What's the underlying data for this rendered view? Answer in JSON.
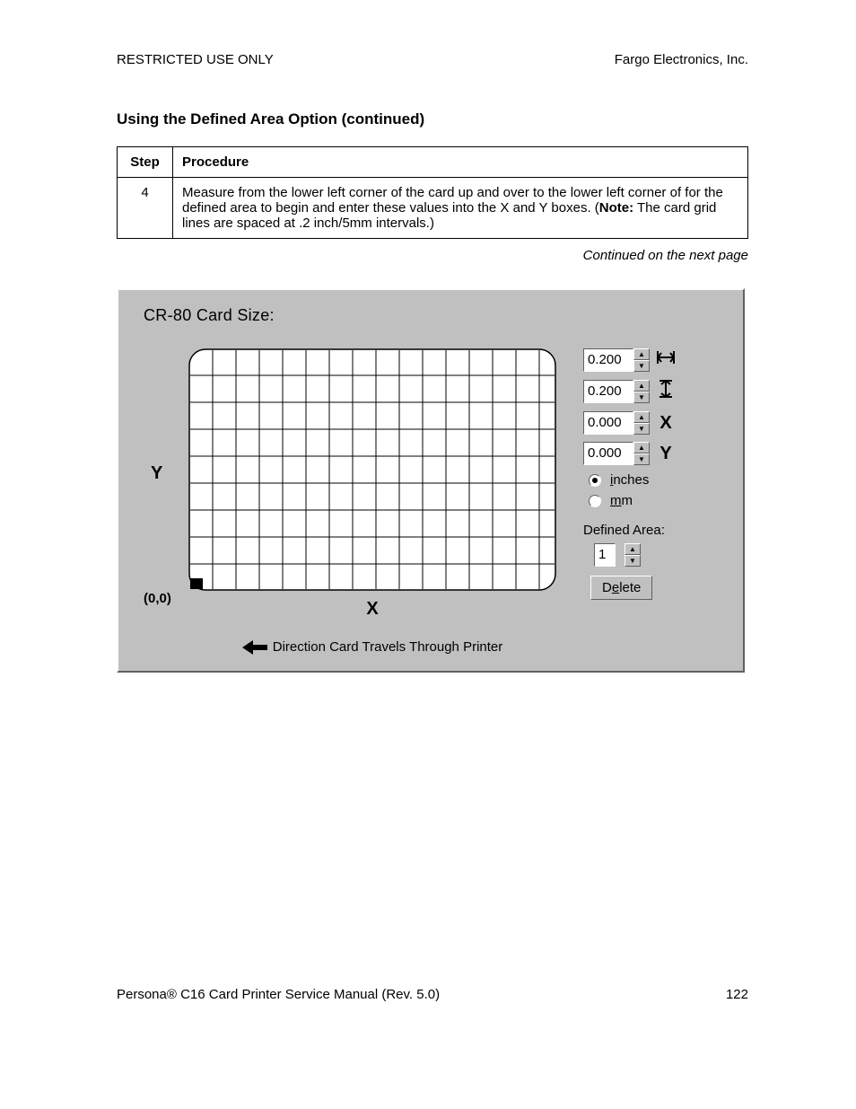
{
  "header": {
    "left": "RESTRICTED USE ONLY",
    "right": "Fargo Electronics, Inc."
  },
  "section_title": "Using the Defined Area Option (continued)",
  "table": {
    "head_step": "Step",
    "head_proc": "Procedure",
    "step": "4",
    "proc_before_note": "Measure from the lower left corner of the card up and over to the lower left corner of for the defined area to begin and enter these values into the X and Y boxes. (",
    "note_label": "Note:",
    "proc_after_note": "  The card grid lines are spaced at .2 inch/5mm intervals.)"
  },
  "continued": "Continued on the next page",
  "dialog": {
    "title": "CR-80 Card Size:",
    "y_label": "Y",
    "x_label": "X",
    "origin": "(0,0)",
    "direction": "Direction Card Travels Through Printer",
    "width_value": "0.200",
    "height_value": "0.200",
    "x_value": "0.000",
    "y_value": "0.000",
    "dim_x_label": "X",
    "dim_y_label": "Y",
    "unit_inches": "inches",
    "unit_mm": "mm",
    "unit_inches_ul": "i",
    "unit_mm_ul": "m",
    "defined_area_label": "Defined Area:",
    "defined_area_value": "1",
    "delete_btn": "Delete",
    "delete_ul": "e"
  },
  "footer": {
    "left": "Persona® C16 Card Printer Service Manual (Rev. 5.0)",
    "page": "122"
  }
}
